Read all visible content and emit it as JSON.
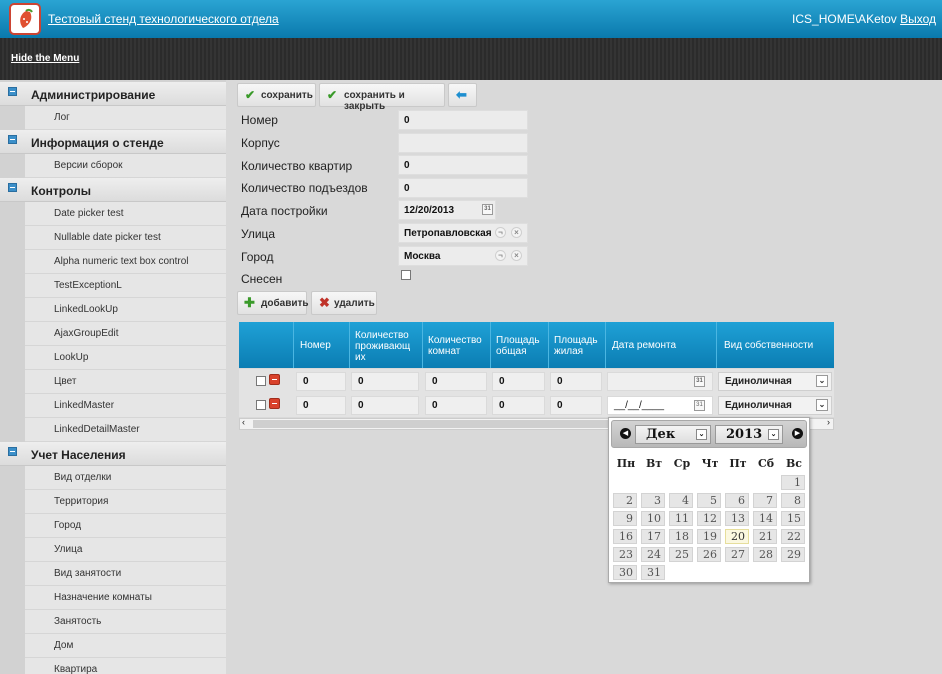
{
  "header": {
    "title": "Тестовый стенд технологического отдела",
    "user": "ICS_HOME\\AKetov",
    "logout": "Выход"
  },
  "menubar": {
    "hide_menu": "Hide the Menu"
  },
  "sidebar": {
    "groups": [
      {
        "label": "Администрирование",
        "items": [
          "Лог"
        ]
      },
      {
        "label": "Информация о стенде",
        "items": [
          "Версии сборок"
        ]
      },
      {
        "label": "Контролы",
        "items": [
          "Date picker test",
          "Nullable date picker test",
          "Alpha numeric text box control",
          "TestExceptionL",
          "LinkedLookUp",
          "AjaxGroupEdit",
          "LookUp",
          "Цвет",
          "LinkedMaster",
          "LinkedDetailMaster"
        ]
      },
      {
        "label": "Учет Населения",
        "items": [
          "Вид отделки",
          "Территория",
          "Город",
          "Улица",
          "Вид занятости",
          "Назначение комнаты",
          "Занятость",
          "Дом",
          "Квартира"
        ]
      }
    ]
  },
  "toolbar": {
    "save": "сохранить",
    "save_close": "сохранить и закрыть"
  },
  "form": {
    "number": {
      "label": "Номер",
      "value": "0"
    },
    "building": {
      "label": "Корпус",
      "value": ""
    },
    "apartments": {
      "label": "Количество квартир",
      "value": "0"
    },
    "entrances": {
      "label": "Количество подъездов",
      "value": "0"
    },
    "build_date": {
      "label": "Дата постройки",
      "value": "12/20/2013"
    },
    "street": {
      "label": "Улица",
      "value": "Петропавловская"
    },
    "city": {
      "label": "Город",
      "value": "Москва"
    },
    "demolished": {
      "label": "Снесен",
      "checked": false
    }
  },
  "grid_toolbar": {
    "add": "добавить",
    "delete": "удалить"
  },
  "grid": {
    "columns": [
      "Номер",
      "Количество проживающ их",
      "Количество комнат",
      "Площадь общая",
      "Площадь жилая",
      "Дата ремонта",
      "Вид собственности"
    ],
    "rows": [
      {
        "number": "0",
        "residents": "0",
        "rooms": "0",
        "area_total": "0",
        "area_living": "0",
        "repair_date": "",
        "ownership": "Единоличная"
      },
      {
        "number": "0",
        "residents": "0",
        "rooms": "0",
        "area_total": "0",
        "area_living": "0",
        "repair_date": "__/__/____",
        "ownership": "Единоличная"
      }
    ]
  },
  "calendar": {
    "month": "Дек",
    "year": "2013",
    "weekdays": [
      "Пн",
      "Вт",
      "Ср",
      "Чт",
      "Пт",
      "Сб",
      "Вс"
    ],
    "today": "20",
    "days": [
      "1",
      "2",
      "3",
      "4",
      "5",
      "6",
      "7",
      "8",
      "9",
      "10",
      "11",
      "12",
      "13",
      "14",
      "15",
      "16",
      "17",
      "18",
      "19",
      "20",
      "21",
      "22",
      "23",
      "24",
      "25",
      "26",
      "27",
      "28",
      "29",
      "30",
      "31"
    ]
  },
  "colors": {
    "accent": "#0b7db3",
    "header_top": "#2aa4d3",
    "menubar": "#2b2b2b",
    "delete_red": "#d9412b"
  }
}
